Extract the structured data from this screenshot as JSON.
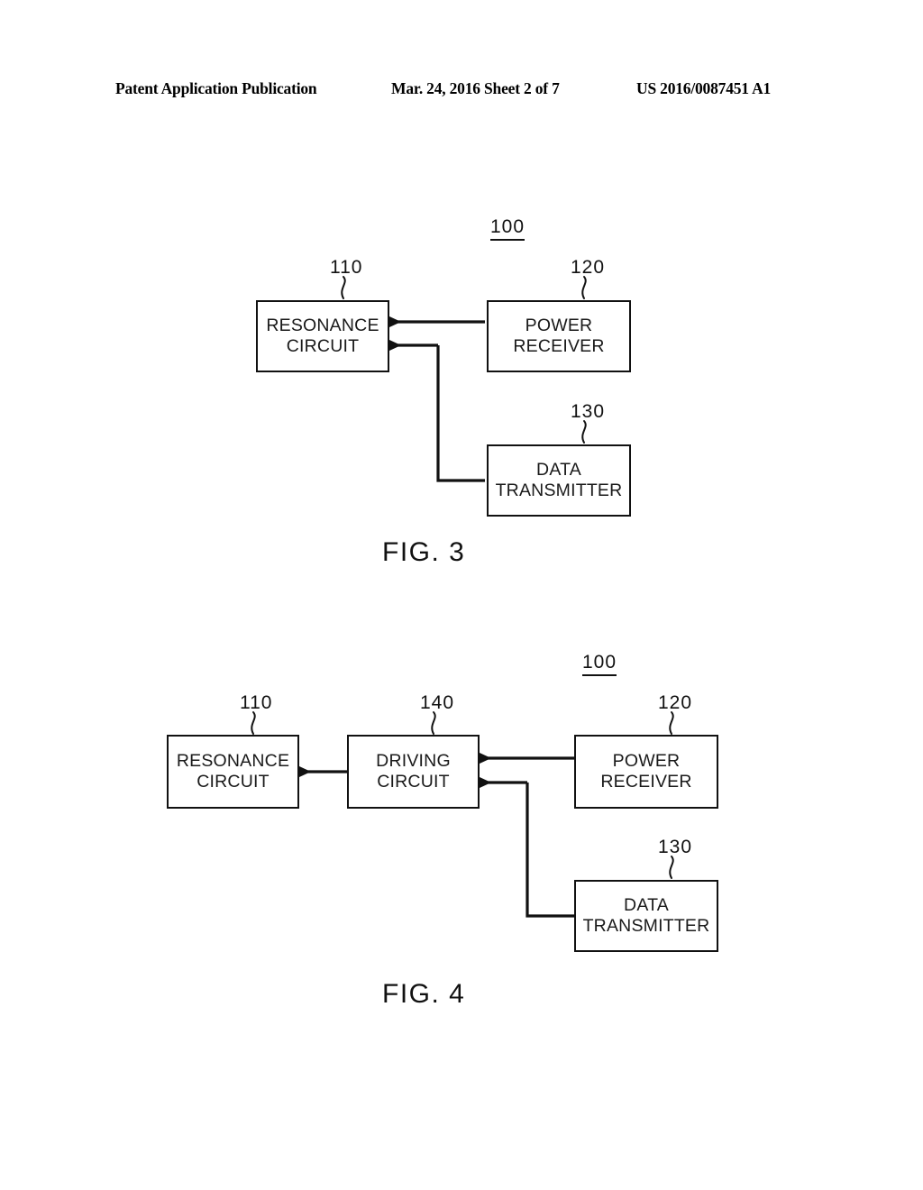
{
  "header": {
    "left": "Patent Application Publication",
    "middle": "Mar. 24, 2016  Sheet 2 of 7",
    "right": "US 2016/0087451 A1"
  },
  "figures": [
    {
      "id": "fig3",
      "caption": "FIG. 3",
      "system_label": "100",
      "blocks": [
        {
          "ref": "110",
          "label": "RESONANCE\nCIRCUIT"
        },
        {
          "ref": "120",
          "label": "POWER\nRECEIVER"
        },
        {
          "ref": "130",
          "label": "DATA\nTRANSMITTER"
        }
      ],
      "connections": [
        {
          "from": "120",
          "to": "110",
          "style": "arrow-left"
        },
        {
          "from": "130",
          "to": "110",
          "style": "arrow-left-elbow"
        }
      ]
    },
    {
      "id": "fig4",
      "caption": "FIG. 4",
      "system_label": "100",
      "blocks": [
        {
          "ref": "110",
          "label": "RESONANCE\nCIRCUIT"
        },
        {
          "ref": "140",
          "label": "DRIVING\nCIRCUIT"
        },
        {
          "ref": "120",
          "label": "POWER\nRECEIVER"
        },
        {
          "ref": "130",
          "label": "DATA\nTRANSMITTER"
        }
      ],
      "connections": [
        {
          "from": "140",
          "to": "110",
          "style": "arrow-left"
        },
        {
          "from": "120",
          "to": "140",
          "style": "arrow-left"
        },
        {
          "from": "130",
          "to": "140",
          "style": "arrow-left-elbow"
        }
      ]
    }
  ]
}
